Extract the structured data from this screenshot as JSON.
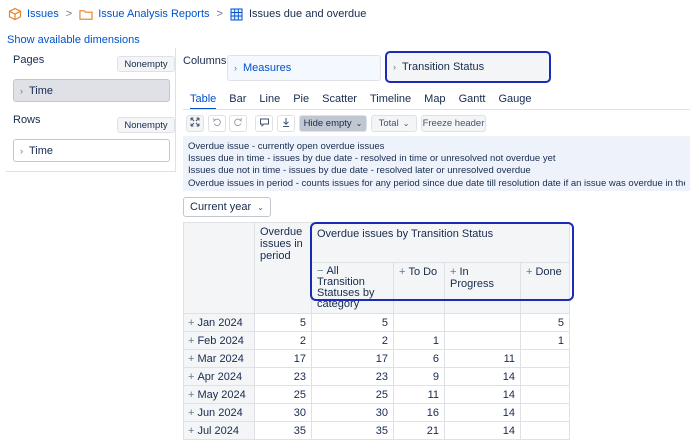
{
  "breadcrumb": {
    "issues": "Issues",
    "separator": ">",
    "reports": "Issue Analysis Reports",
    "current": "Issues due and overdue"
  },
  "show_dimensions": "Show available dimensions",
  "pages": {
    "label": "Pages",
    "nonempty": "Nonempty",
    "item": "Time"
  },
  "rows": {
    "label": "Rows",
    "nonempty": "Nonempty",
    "item": "Time"
  },
  "columns": {
    "label": "Columns",
    "measures": "Measures",
    "transition_status": "Transition Status"
  },
  "tabs": [
    "Table",
    "Bar",
    "Line",
    "Pie",
    "Scatter",
    "Timeline",
    "Map",
    "Gantt",
    "Gauge"
  ],
  "toolbar": {
    "hide_empty": "Hide empty",
    "total": "Total",
    "freeze_header": "Freeze header"
  },
  "info_lines": [
    "Overdue issue - currently open overdue issues",
    "Issues due in time - issues by due date - resolved in time or unresolved not overdue yet",
    "Issues due not in time - issues by due date - resolved later or unresolved overdue",
    "Overdue issues in period - counts issues for any period since due date till resolution date if an issue was overdue in the period."
  ],
  "current_year": "Current year",
  "table": {
    "measure_header": "Overdue issues in period",
    "group_header": "Overdue issues by Transition Status",
    "sub_headers": [
      "All Transition Statuses by category",
      "To Do",
      "In Progress",
      "Done"
    ],
    "rows": [
      {
        "label": "Jan 2024",
        "period": "5",
        "all": "5",
        "todo": "",
        "inprogress": "",
        "done": "5"
      },
      {
        "label": "Feb 2024",
        "period": "2",
        "all": "2",
        "todo": "1",
        "inprogress": "",
        "done": "1"
      },
      {
        "label": "Mar 2024",
        "period": "17",
        "all": "17",
        "todo": "6",
        "inprogress": "11",
        "done": ""
      },
      {
        "label": "Apr 2024",
        "period": "23",
        "all": "23",
        "todo": "9",
        "inprogress": "14",
        "done": ""
      },
      {
        "label": "May 2024",
        "period": "25",
        "all": "25",
        "todo": "11",
        "inprogress": "14",
        "done": ""
      },
      {
        "label": "Jun 2024",
        "period": "30",
        "all": "30",
        "todo": "16",
        "inprogress": "14",
        "done": ""
      },
      {
        "label": "Jul 2024",
        "period": "35",
        "all": "35",
        "todo": "21",
        "inprogress": "14",
        "done": ""
      }
    ]
  },
  "icons": {
    "issues": "cube-icon",
    "reports": "folder-icon",
    "current": "table-grid-icon"
  },
  "colors": {
    "link": "#0052cc",
    "highlight": "#1a2bb8",
    "info_bg": "#eef3fb"
  }
}
